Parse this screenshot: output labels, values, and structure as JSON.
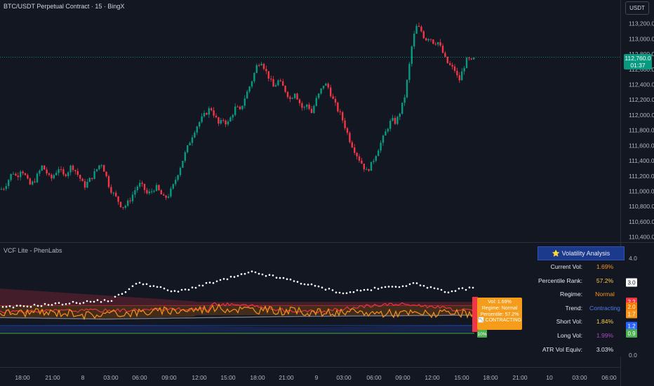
{
  "header": {
    "title": "BTC/USDT Perpetual Contract · 15 · BingX",
    "currency_button": "USDT"
  },
  "price_tag": {
    "price": "112,760.0",
    "countdown": "01:37"
  },
  "price_axis": {
    "labels": [
      "113,200.0",
      "113,000.0",
      "112,800.0",
      "112,600.0",
      "112,400.0",
      "112,200.0",
      "112,000.0",
      "111,800.0",
      "111,600.0",
      "111,400.0",
      "111,200.0",
      "111,000.0",
      "110,800.0",
      "110,600.0",
      "110,400.0"
    ]
  },
  "indicator": {
    "title": "VCF Lite - PhenLabs",
    "axis_labels": [
      "4.0",
      "0.0"
    ],
    "badges": [
      {
        "value": "3.0",
        "color": "#ffffff"
      },
      {
        "value": "2.2",
        "color": "#f23645"
      },
      {
        "value": "2.0",
        "color": "#f57c00"
      },
      {
        "value": "1.7",
        "color": "#787b86"
      },
      {
        "value": "1.7",
        "color": "#f7931a"
      },
      {
        "value": "1.2",
        "color": "#2962ff"
      },
      {
        "value": "0.9",
        "color": "#4caf50"
      }
    ],
    "label": {
      "lines": [
        "Vol: 1.69%",
        "Regime: Normal",
        "Percentile: 57.2%",
        "📉 CONTRACTING"
      ],
      "small_badge": "10%"
    }
  },
  "volatility_table": {
    "header": "⭐ Volatility Analysis",
    "rows": [
      {
        "key": "Current Vol:",
        "value": "1.69%",
        "color": "#f7931a"
      },
      {
        "key": "Percentile Rank:",
        "value": "57.2%",
        "color": "#f7c948"
      },
      {
        "key": "Regime:",
        "value": "Normal",
        "color": "#f7931a"
      },
      {
        "key": "Trend:",
        "value": "Contracting",
        "color": "#4f7df0"
      },
      {
        "key": "Short Vol:",
        "value": "1.84%",
        "color": "#f7c948"
      },
      {
        "key": "Long Vol:",
        "value": "1.99%",
        "color": "#ab47bc"
      },
      {
        "key": "ATR Vol Equiv:",
        "value": "3.03%",
        "color": "#e6e8ee"
      }
    ]
  },
  "time_axis": {
    "labels": [
      "18:00",
      "21:00",
      "8",
      "03:00",
      "06:00",
      "09:00",
      "12:00",
      "15:00",
      "18:00",
      "21:00",
      "9",
      "03:00",
      "06:00",
      "09:00",
      "12:00",
      "15:00",
      "18:00",
      "21:00",
      "10",
      "03:00",
      "06:00"
    ]
  },
  "colors": {
    "background": "#131722",
    "up_candle": "#089981",
    "down_candle": "#f23645",
    "current_vol": "#f7931a",
    "atr_dots": "#ffffff"
  },
  "chart_data": {
    "type": "candlestick",
    "title": "BTC/USDT Perpetual Contract · 15 · BingX",
    "ylim": [
      110350,
      113400
    ],
    "last_price": 112760,
    "price_path": [
      [
        0,
        111020
      ],
      [
        6,
        111050
      ],
      [
        12,
        111150
      ],
      [
        18,
        111260
      ],
      [
        24,
        111180
      ],
      [
        30,
        111300
      ],
      [
        36,
        111200
      ],
      [
        42,
        111080
      ],
      [
        48,
        111120
      ],
      [
        54,
        111220
      ],
      [
        60,
        111330
      ],
      [
        66,
        111250
      ],
      [
        72,
        111150
      ],
      [
        78,
        111230
      ],
      [
        84,
        111310
      ],
      [
        90,
        111200
      ],
      [
        96,
        111250
      ],
      [
        102,
        111340
      ],
      [
        108,
        111260
      ],
      [
        114,
        111170
      ],
      [
        120,
        111060
      ],
      [
        126,
        111130
      ],
      [
        132,
        111200
      ],
      [
        138,
        111290
      ],
      [
        144,
        111380
      ],
      [
        150,
        111240
      ],
      [
        156,
        111050
      ],
      [
        162,
        110960
      ],
      [
        168,
        110880
      ],
      [
        174,
        110790
      ],
      [
        180,
        110820
      ],
      [
        186,
        110900
      ],
      [
        192,
        111010
      ],
      [
        198,
        111100
      ],
      [
        204,
        111050
      ],
      [
        210,
        110960
      ],
      [
        216,
        111000
      ],
      [
        222,
        111060
      ],
      [
        228,
        110980
      ],
      [
        234,
        110900
      ],
      [
        240,
        110950
      ],
      [
        246,
        111050
      ],
      [
        252,
        111200
      ],
      [
        258,
        111350
      ],
      [
        264,
        111500
      ],
      [
        270,
        111640
      ],
      [
        276,
        111780
      ],
      [
        282,
        111880
      ],
      [
        288,
        111960
      ],
      [
        294,
        112030
      ],
      [
        300,
        112100
      ],
      [
        306,
        111990
      ],
      [
        312,
        111870
      ],
      [
        318,
        111940
      ],
      [
        324,
        111880
      ],
      [
        330,
        111990
      ],
      [
        336,
        112110
      ],
      [
        342,
        112050
      ],
      [
        348,
        112210
      ],
      [
        354,
        112340
      ],
      [
        360,
        112480
      ],
      [
        366,
        112650
      ],
      [
        372,
        112720
      ],
      [
        378,
        112590
      ],
      [
        384,
        112480
      ],
      [
        390,
        112360
      ],
      [
        396,
        112450
      ],
      [
        402,
        112390
      ],
      [
        408,
        112300
      ],
      [
        414,
        112200
      ],
      [
        420,
        112310
      ],
      [
        426,
        112180
      ],
      [
        432,
        112070
      ],
      [
        438,
        112150
      ],
      [
        444,
        112030
      ],
      [
        450,
        112190
      ],
      [
        456,
        112300
      ],
      [
        462,
        112420
      ],
      [
        468,
        112360
      ],
      [
        474,
        112210
      ],
      [
        480,
        112090
      ],
      [
        486,
        111990
      ],
      [
        492,
        111840
      ],
      [
        498,
        111680
      ],
      [
        504,
        111560
      ],
      [
        510,
        111450
      ],
      [
        516,
        111360
      ],
      [
        522,
        111260
      ],
      [
        528,
        111330
      ],
      [
        534,
        111450
      ],
      [
        540,
        111580
      ],
      [
        546,
        111700
      ],
      [
        552,
        111830
      ],
      [
        558,
        111940
      ],
      [
        564,
        111900
      ],
      [
        570,
        112040
      ],
      [
        576,
        112210
      ],
      [
        582,
        112560
      ],
      [
        588,
        112980
      ],
      [
        594,
        113170
      ],
      [
        600,
        113110
      ],
      [
        606,
        112990
      ],
      [
        612,
        113030
      ],
      [
        618,
        112950
      ],
      [
        624,
        112960
      ],
      [
        630,
        112840
      ],
      [
        636,
        112700
      ],
      [
        642,
        112640
      ],
      [
        648,
        112590
      ],
      [
        654,
        112440
      ],
      [
        660,
        112610
      ],
      [
        666,
        112740
      ],
      [
        672,
        112700
      ],
      [
        678,
        112760
      ]
    ],
    "indicator": {
      "ylim": [
        0,
        4.0
      ],
      "current_vol_last": 1.69,
      "atr_vol_equiv_last": 3.03,
      "short_vol_last": 1.84,
      "long_vol_last": 1.99,
      "percentile_rank": 57.2,
      "regime": "Normal",
      "trend": "Contracting"
    }
  }
}
